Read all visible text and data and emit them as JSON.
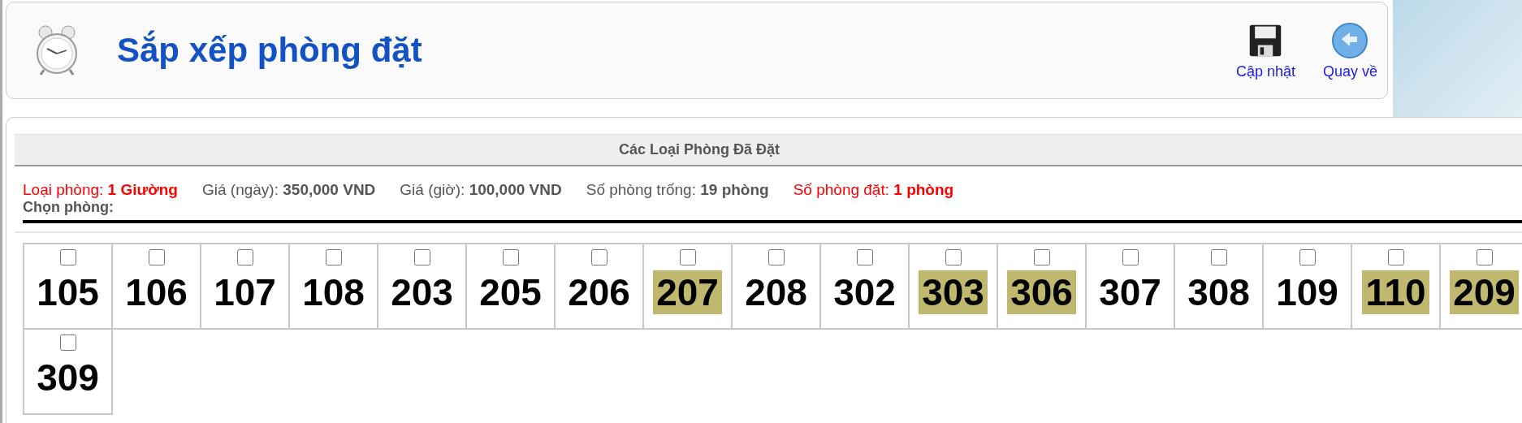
{
  "header": {
    "title": "Sắp xếp phòng đặt",
    "actions": [
      {
        "label": "Cập nhật",
        "kind": "save"
      },
      {
        "label": "Quay về",
        "kind": "back"
      }
    ]
  },
  "section": {
    "title": "Các Loại Phòng Đã Đặt",
    "info": [
      {
        "label": "Loại phòng:",
        "value": "1 Giường",
        "kind": "alert"
      },
      {
        "label": "Giá (ngày):",
        "value": "350,000 VND",
        "kind": "normal"
      },
      {
        "label": "Giá (giờ):",
        "value": "100,000 VND",
        "kind": "normal"
      },
      {
        "label": "Số phòng trống:",
        "value": "19 phòng",
        "kind": "normal"
      },
      {
        "label": "Số phòng đặt:",
        "value": "1 phòng",
        "kind": "alert"
      }
    ],
    "choose_label": "Chọn phòng:",
    "rooms": [
      {
        "number": "105",
        "checked": false,
        "highlighted": false
      },
      {
        "number": "106",
        "checked": false,
        "highlighted": false
      },
      {
        "number": "107",
        "checked": false,
        "highlighted": false
      },
      {
        "number": "108",
        "checked": false,
        "highlighted": false
      },
      {
        "number": "203",
        "checked": false,
        "highlighted": false
      },
      {
        "number": "205",
        "checked": false,
        "highlighted": false
      },
      {
        "number": "206",
        "checked": false,
        "highlighted": false
      },
      {
        "number": "207",
        "checked": false,
        "highlighted": true
      },
      {
        "number": "208",
        "checked": false,
        "highlighted": false
      },
      {
        "number": "302",
        "checked": false,
        "highlighted": false
      },
      {
        "number": "303",
        "checked": false,
        "highlighted": true
      },
      {
        "number": "306",
        "checked": false,
        "highlighted": true
      },
      {
        "number": "307",
        "checked": false,
        "highlighted": false
      },
      {
        "number": "308",
        "checked": false,
        "highlighted": false
      },
      {
        "number": "109",
        "checked": false,
        "highlighted": false
      },
      {
        "number": "110",
        "checked": false,
        "highlighted": true
      },
      {
        "number": "209",
        "checked": false,
        "highlighted": true
      },
      {
        "number": "309",
        "checked": false,
        "highlighted": false
      }
    ]
  }
}
